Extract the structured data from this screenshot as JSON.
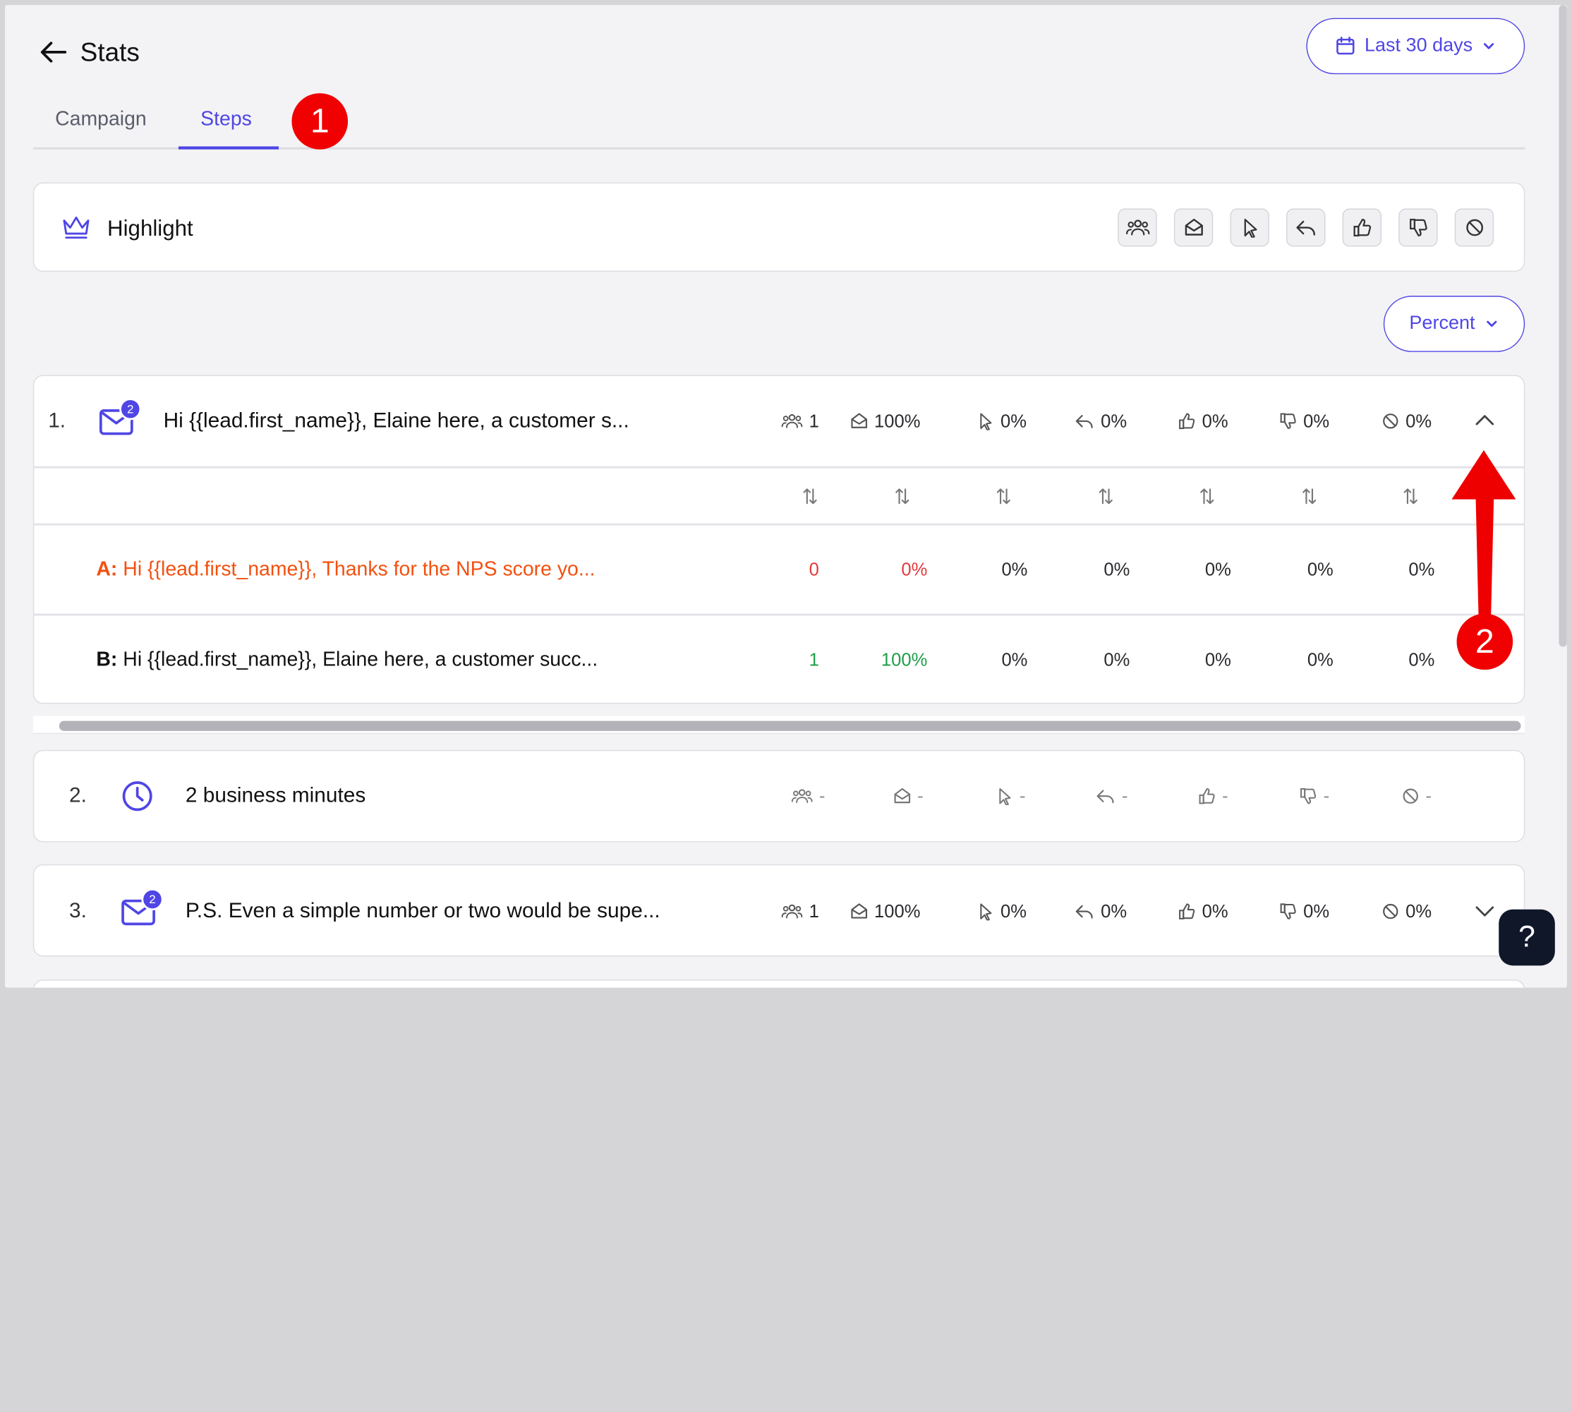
{
  "header": {
    "title": "Stats",
    "date_range_label": "Last 30 days"
  },
  "tabs": [
    {
      "label": "Campaign",
      "active": false
    },
    {
      "label": "Steps",
      "active": true
    }
  ],
  "annotations": {
    "marker_1": "1",
    "marker_2": "2"
  },
  "highlight": {
    "label": "Highlight",
    "icons": [
      "users-icon",
      "envelope-open-icon",
      "cursor-icon",
      "reply-icon",
      "thumbs-up-icon",
      "thumbs-down-icon",
      "ban-icon"
    ]
  },
  "view_mode": {
    "label": "Percent"
  },
  "steps": [
    {
      "number": "1.",
      "type": "email",
      "variant_count": "2",
      "subject": "Hi {{lead.first_name}}, Elaine here, a customer s...",
      "stats": {
        "leads": "1",
        "opened": "100%",
        "clicked": "0%",
        "replied": "0%",
        "positive": "0%",
        "negative": "0%",
        "bounced": "0%"
      },
      "expanded": true,
      "variants": [
        {
          "label": "A:",
          "subject": "Hi {{lead.first_name}}, Thanks for the NPS score yo...",
          "leads": "0",
          "opened": "0%",
          "clicked": "0%",
          "replied": "0%",
          "positive": "0%",
          "negative": "0%",
          "bounced": "0%",
          "color": "#f4500f",
          "value_color": "#e5383b"
        },
        {
          "label": "B:",
          "subject": "Hi {{lead.first_name}}, Elaine here, a customer succ...",
          "leads": "1",
          "opened": "100%",
          "clicked": "0%",
          "replied": "0%",
          "positive": "0%",
          "negative": "0%",
          "bounced": "0%",
          "color": "#111111",
          "value_color": "#1e9e4a"
        }
      ]
    },
    {
      "number": "2.",
      "type": "delay",
      "subject": "2 business minutes",
      "stats": {
        "leads": "-",
        "opened": "-",
        "clicked": "-",
        "replied": "-",
        "positive": "-",
        "negative": "-",
        "bounced": "-"
      }
    },
    {
      "number": "3.",
      "type": "email",
      "variant_count": "2",
      "subject": "P.S. Even a simple number or two would be supe...",
      "stats": {
        "leads": "1",
        "opened": "100%",
        "clicked": "0%",
        "replied": "0%",
        "positive": "0%",
        "negative": "0%",
        "bounced": "0%"
      },
      "expanded": false
    }
  ],
  "help_label": "?",
  "colors": {
    "accent": "#4f46e5",
    "annotation_red": "#f00000"
  }
}
